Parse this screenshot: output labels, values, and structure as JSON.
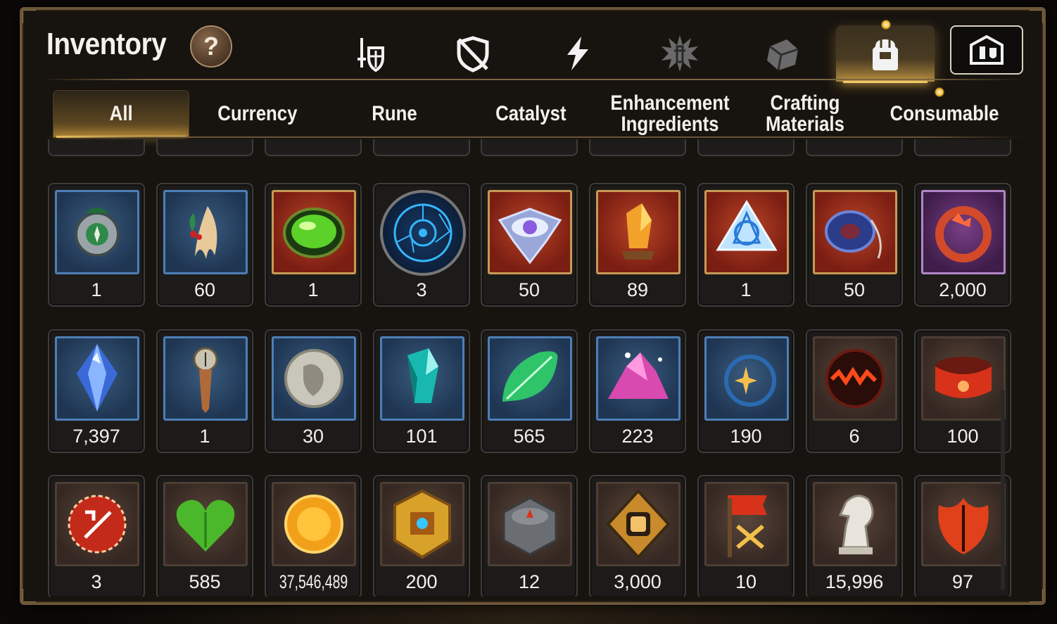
{
  "header": {
    "title": "Inventory",
    "help_label": "?"
  },
  "category_tabs": [
    {
      "icon": "equipment-icon"
    },
    {
      "icon": "no-shield-icon"
    },
    {
      "icon": "lightning-icon"
    },
    {
      "icon": "burst-icon"
    },
    {
      "icon": "cube-icon"
    },
    {
      "icon": "backpack-icon",
      "active": true
    }
  ],
  "bag_button_icon": "guild-bag-icon",
  "sub_tabs": [
    {
      "label": "All",
      "active": true
    },
    {
      "label": "Currency"
    },
    {
      "label": "Rune"
    },
    {
      "label": "Catalyst"
    },
    {
      "label": "Enhancement Ingredients"
    },
    {
      "label": "Crafting Materials"
    },
    {
      "label": "Consumable"
    }
  ],
  "colors": {
    "accent": "#f2c760",
    "panel_bg": "#17130f",
    "border": "#6b5638"
  },
  "rows": [
    [
      {
        "qty": "1",
        "icon": "green-compass-amulet-icon",
        "frame": "blue"
      },
      {
        "qty": "60",
        "icon": "ginseng-root-icon",
        "frame": "blue"
      },
      {
        "qty": "1",
        "icon": "green-gem-icon",
        "frame": "red"
      },
      {
        "qty": "3",
        "icon": "blue-rune-circle-icon",
        "frame": "round"
      },
      {
        "qty": "50",
        "icon": "eye-crest-icon",
        "frame": "red"
      },
      {
        "qty": "89",
        "icon": "amber-crystal-icon",
        "frame": "red"
      },
      {
        "qty": "1",
        "icon": "triquetra-crystal-icon",
        "frame": "red"
      },
      {
        "qty": "50",
        "icon": "blue-ring-pendant-icon",
        "frame": "red"
      },
      {
        "qty": "2,000",
        "icon": "red-flower-ring-icon",
        "frame": "purple"
      }
    ],
    [
      {
        "qty": "7,397",
        "icon": "blue-diamond-icon",
        "frame": "blue"
      },
      {
        "qty": "1",
        "icon": "compass-dagger-icon",
        "frame": "blue"
      },
      {
        "qty": "30",
        "icon": "silver-coin-icon",
        "frame": "blue"
      },
      {
        "qty": "101",
        "icon": "teal-crystal-icon",
        "frame": "blue"
      },
      {
        "qty": "565",
        "icon": "green-leaf-icon",
        "frame": "blue"
      },
      {
        "qty": "223",
        "icon": "pink-ore-icon",
        "frame": "blue"
      },
      {
        "qty": "190",
        "icon": "star-pendant-icon",
        "frame": "blue"
      },
      {
        "qty": "6",
        "icon": "lava-orb-icon",
        "frame": "brown"
      },
      {
        "qty": "100",
        "icon": "red-bracelet-icon",
        "frame": "brown"
      }
    ],
    [
      {
        "qty": "3",
        "icon": "red-seal-icon",
        "frame": "brown"
      },
      {
        "qty": "585",
        "icon": "green-heart-icon",
        "frame": "brown"
      },
      {
        "qty": "37,546,489",
        "icon": "gold-coin-icon",
        "frame": "brown",
        "narrow": true
      },
      {
        "qty": "200",
        "icon": "gold-emblem-icon",
        "frame": "brown"
      },
      {
        "qty": "12",
        "icon": "stone-compass-icon",
        "frame": "brown"
      },
      {
        "qty": "3,000",
        "icon": "fist-badge-icon",
        "frame": "brown"
      },
      {
        "qty": "10",
        "icon": "war-banner-icon",
        "frame": "brown"
      },
      {
        "qty": "15,996",
        "icon": "knight-piece-icon",
        "frame": "brown"
      },
      {
        "qty": "97",
        "icon": "red-leaf-icon",
        "frame": "brown"
      }
    ]
  ]
}
